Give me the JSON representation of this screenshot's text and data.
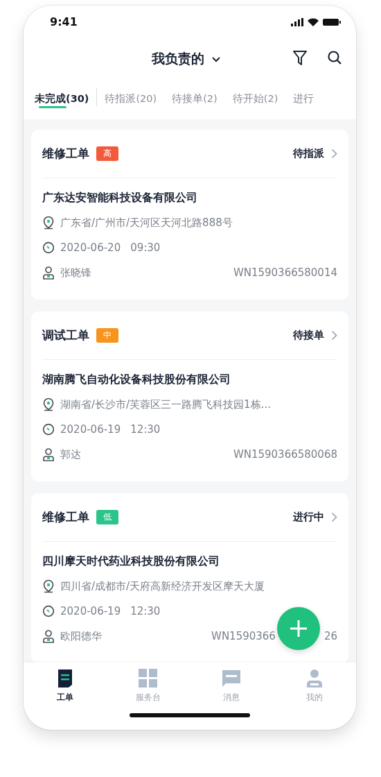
{
  "status_bar": {
    "time": "9:41"
  },
  "header": {
    "title": "我负责的"
  },
  "tabs": [
    {
      "label": "未完成(30)",
      "selected": true
    },
    {
      "label": "待指派(20)",
      "selected": false
    },
    {
      "label": "待接单(2)",
      "selected": false
    },
    {
      "label": "待开始(2)",
      "selected": false
    },
    {
      "label": "进行",
      "selected": false
    }
  ],
  "orders": [
    {
      "type": "维修工单",
      "priority": "高",
      "color": "#f25a3c",
      "status": "待指派",
      "company": "广东达安智能科技设备有限公司",
      "address": "广东省/广州市/天河区天河北路888号",
      "date": "2020-06-20",
      "time": "09:30",
      "person": "张晓锋",
      "code_parts": [
        "WN1590366580014"
      ]
    },
    {
      "type": "调试工单",
      "priority": "中",
      "color": "#f7941d",
      "status": "待接单",
      "company": "湖南腾飞自动化设备科技股份有限公司",
      "address": "湖南省/长沙市/芙蓉区三一路腾飞科技园1栋...",
      "date": "2020-06-19",
      "time": "12:30",
      "person": "郭达",
      "code_parts": [
        "WN1590366580068"
      ]
    },
    {
      "type": "维修工单",
      "priority": "低",
      "color": "#2bc489",
      "status": "进行中",
      "company": "四川摩天时代药业科技股份有限公司",
      "address": "四川省/成都市/天府高新经济开发区摩天大厦",
      "date": "2020-06-19",
      "time": "12:30",
      "person": "欧阳德华",
      "code_parts": [
        "WN1590366",
        "26"
      ]
    }
  ],
  "tab_bar": [
    {
      "label": "工单",
      "kind": "doc",
      "selected": true
    },
    {
      "label": "服务台",
      "kind": "grid",
      "selected": false
    },
    {
      "label": "消息",
      "kind": "chat",
      "selected": false
    },
    {
      "label": "我的",
      "kind": "user",
      "selected": false
    }
  ]
}
